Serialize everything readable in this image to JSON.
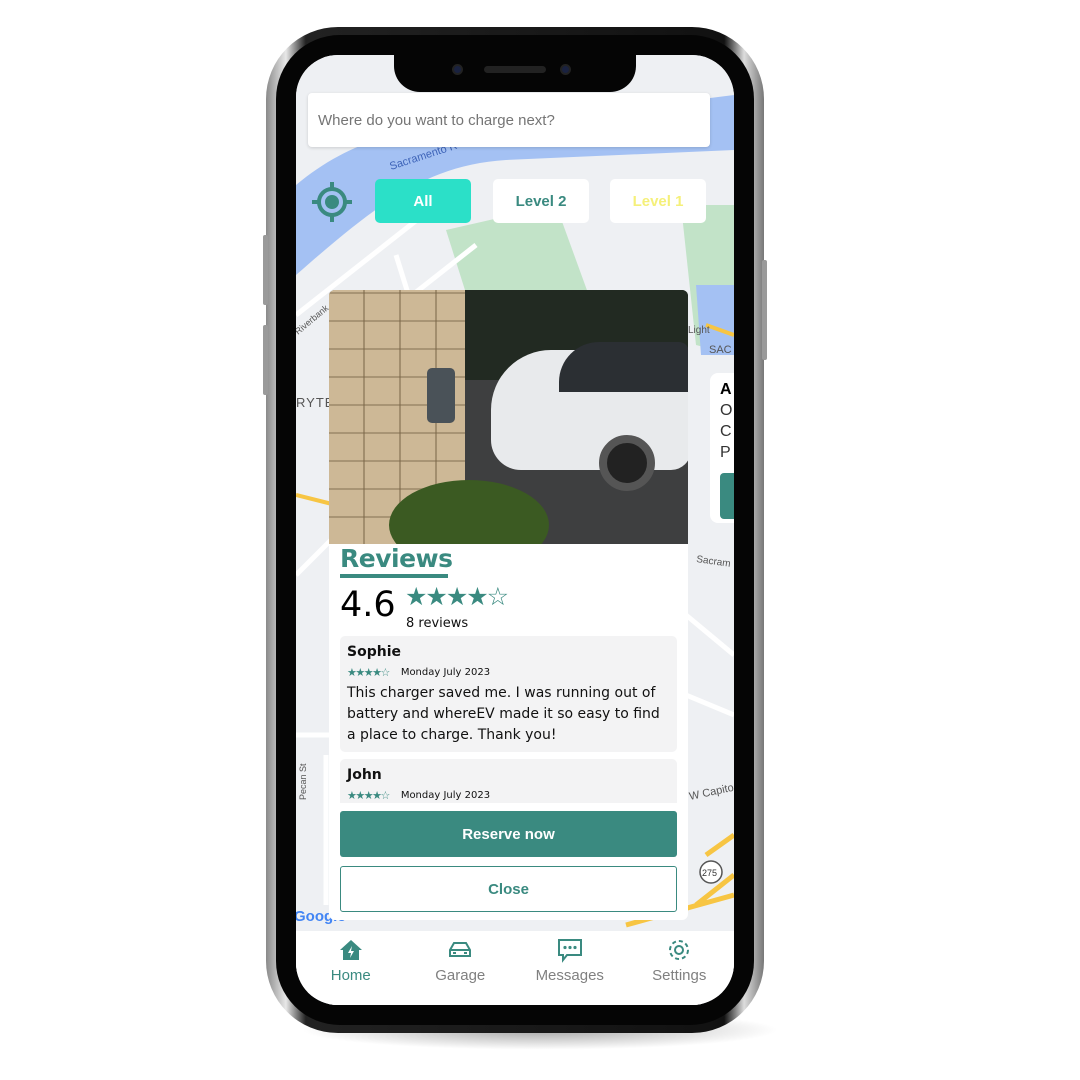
{
  "search": {
    "placeholder": "Where do you want to charge next?"
  },
  "filters": [
    {
      "label": "All",
      "active": true
    },
    {
      "label": "Level 2",
      "active": false
    },
    {
      "label": "Level 1",
      "active": false
    }
  ],
  "colors": {
    "accent": "#3a8a80",
    "chip_active": "#2be0c8",
    "level1_text": "#f5f07a"
  },
  "side_card_letters": [
    "A",
    "O",
    "C",
    "P"
  ],
  "charger_card": {
    "reviews_title": "Reviews",
    "rating": "4.6",
    "rating_value": 4.6,
    "review_count": "8 reviews",
    "reviews": [
      {
        "name": "Sophie",
        "stars": 4.5,
        "date": "Monday July 2023",
        "text": "This charger saved me. I was running out of battery and whereEV made it so easy to find a place to charge. Thank you!"
      },
      {
        "name": "John",
        "stars": 4.5,
        "date": "Monday July 2023",
        "text": ""
      }
    ],
    "reserve_label": "Reserve now",
    "close_label": "Close"
  },
  "map_labels": {
    "river": "Sacramento R",
    "riverbank": "Riverbank",
    "bryte": "RYTE",
    "pecan": "Pecan St",
    "capitol": "W Capito",
    "sacramento": "Sacram",
    "light": "Light",
    "sac": "SAC",
    "highway": "275",
    "google": "Google"
  },
  "tabbar": [
    {
      "label": "Home",
      "icon": "home-bolt-icon",
      "active": true
    },
    {
      "label": "Garage",
      "icon": "car-icon",
      "active": false
    },
    {
      "label": "Messages",
      "icon": "chat-icon",
      "active": false
    },
    {
      "label": "Settings",
      "icon": "gear-icon",
      "active": false
    }
  ]
}
